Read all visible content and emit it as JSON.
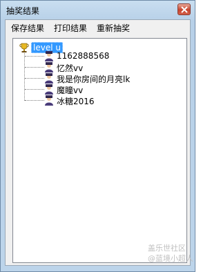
{
  "window": {
    "title": "抽奖结果"
  },
  "menu": {
    "items": [
      {
        "label": "保存结果"
      },
      {
        "label": "打印结果"
      },
      {
        "label": "重新抽奖"
      }
    ]
  },
  "tree": {
    "root": {
      "label": "level u"
    },
    "children": [
      {
        "label": "1162888568"
      },
      {
        "label": "忆然vv"
      },
      {
        "label": "我是你房间的月亮lk"
      },
      {
        "label": "魔瞳vv"
      },
      {
        "label": "冰糖2016"
      }
    ]
  },
  "watermark": {
    "line1": "盖乐世社区",
    "line2": "@蓝境小超人"
  }
}
